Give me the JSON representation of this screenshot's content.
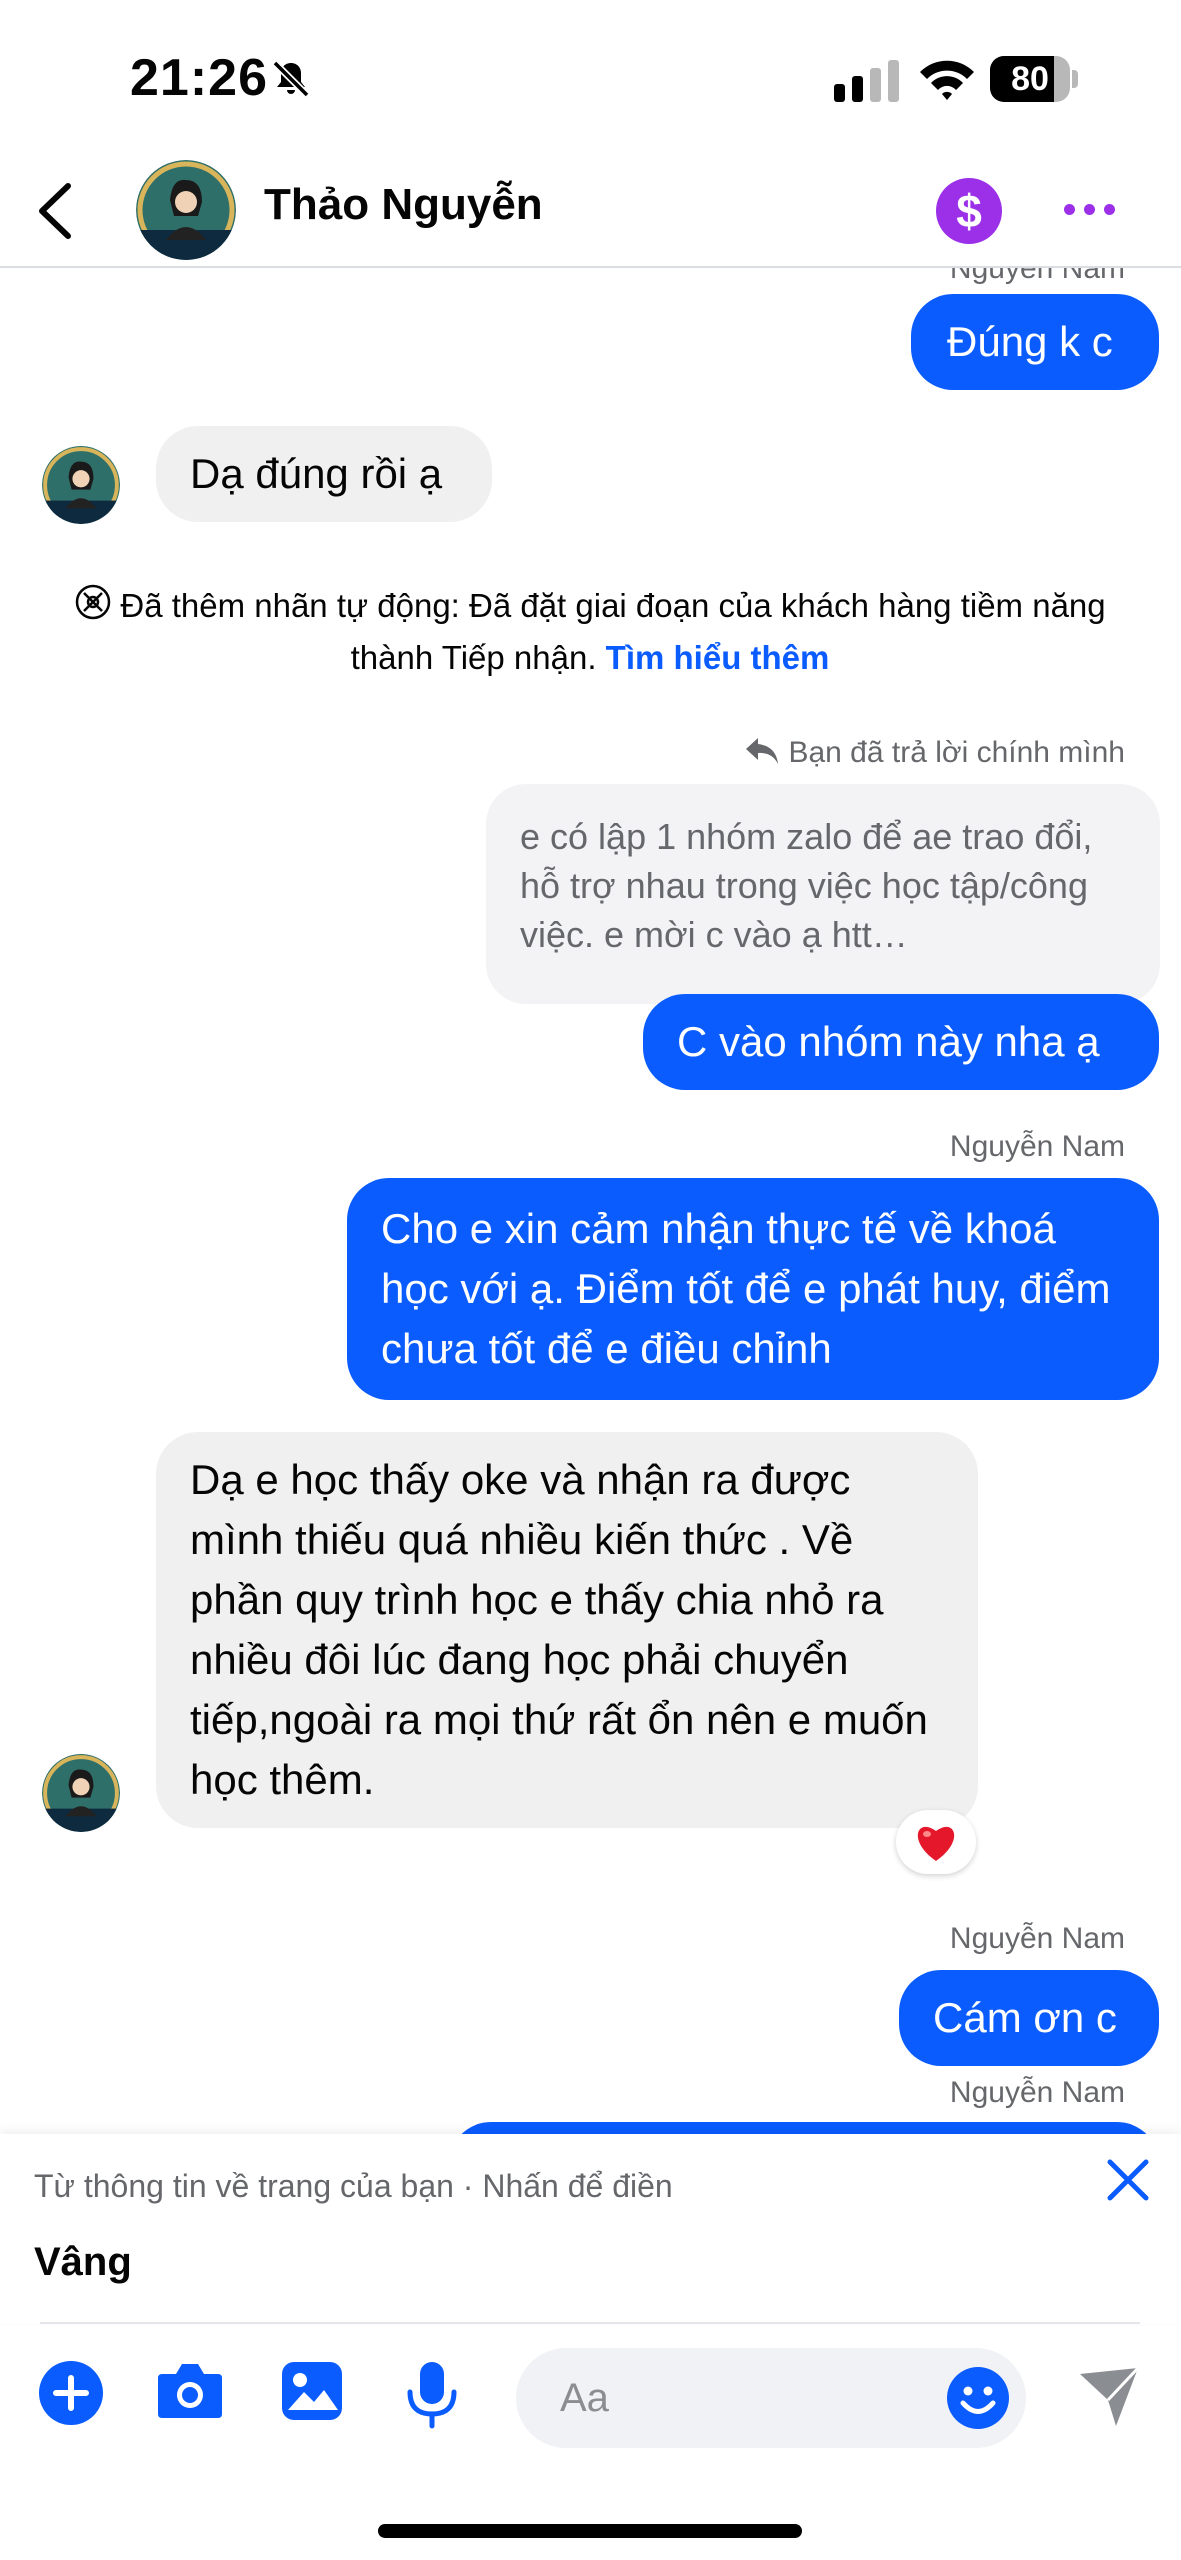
{
  "status_bar": {
    "time": "21:26",
    "battery": "80",
    "battery_level": 0.8
  },
  "header": {
    "contact_name": "Thảo Nguyễn",
    "payment_symbol": "$"
  },
  "conversation": {
    "msg1": {
      "sender": "Nguyễn Nam",
      "text": "Đúng k c"
    },
    "msg2": {
      "text": "Dạ đúng rồi ạ"
    },
    "system": {
      "text": "Đã thêm nhãn tự động: Đã đặt giai đoạn của khách hàng tiềm năng thành Tiếp nhận.",
      "link": "Tìm hiểu thêm"
    },
    "reply_note": "Bạn đã trả lời chính mình",
    "quoted_text": "e có lập 1 nhóm zalo để ae trao đổi, hỗ trợ nhau trong việc học tập/công việc. e mời c vào ạ htt…",
    "msg3": {
      "text": "C vào nhóm này nha ạ"
    },
    "msg4": {
      "sender": "Nguyễn Nam",
      "text": "Cho e xin cảm nhận thực tế về khoá học với ạ. Điểm tốt để e phát huy, điểm chưa tốt để e điều chỉnh"
    },
    "msg5": {
      "text": "Dạ e học thấy oke và nhận ra được mình thiếu quá nhiều kiến thức . Về phần quy trình học e thấy chia nhỏ ra nhiều đôi lúc đang học phải chuyển tiếp,ngoài ra mọi thứ rất ổn nên e muốn học thêm.",
      "reaction": "heart-icon"
    },
    "msg6": {
      "sender": "Nguyễn Nam",
      "text": "Cám ơn c"
    },
    "msg7": {
      "sender": "Nguyễn Nam"
    },
    "cut_top_sender": "Nguyễn Nam"
  },
  "suggestion": {
    "hint": "Từ thông tin về trang của bạn · Nhấn để điền",
    "text": "Vâng"
  },
  "composer": {
    "placeholder": "Aa"
  },
  "colors": {
    "accent": "#0a5cff",
    "purple": "#9b30e8",
    "incoming_bubble": "#f0f0f0"
  },
  "icons": [
    "bell-slash-icon",
    "signal-icon",
    "wifi-icon",
    "back-icon",
    "dollar-icon",
    "more-icon",
    "auto-label-icon",
    "reply-icon",
    "heart-icon",
    "close-icon",
    "plus-icon",
    "camera-icon",
    "image-icon",
    "microphone-icon",
    "emoji-icon",
    "send-icon"
  ]
}
